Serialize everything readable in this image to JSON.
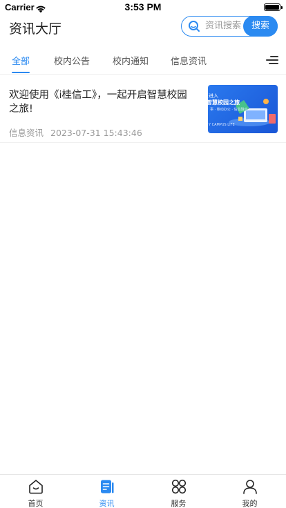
{
  "status_bar": {
    "carrier": "Carrier",
    "time": "3:53 PM",
    "wifi_icon": "wifi-icon",
    "battery_icon": "battery-icon"
  },
  "header": {
    "title": "资讯大厅",
    "search": {
      "placeholder": "资讯搜索",
      "value": "",
      "button_label": "搜索",
      "icon": "search-icon"
    }
  },
  "tabs": {
    "items": [
      {
        "label": "全部",
        "active": true
      },
      {
        "label": "校内公告",
        "active": false
      },
      {
        "label": "校内通知",
        "active": false
      },
      {
        "label": "信息资讯",
        "active": false
      }
    ],
    "menu_icon": "menu-icon"
  },
  "articles": [
    {
      "title": "欢迎使用《i桂信工》，一起开启智慧校园之旅!",
      "category": "信息资讯",
      "date": "2023-07-31 15:43:46",
      "thumbnail": {
        "line1": "进入",
        "line2": "智慧校园之旅",
        "line3": "事 · 移动办公 · 信息融合",
        "line4": "Y CAMPUS LIFE"
      }
    }
  ],
  "tabbar": {
    "items": [
      {
        "label": "首页",
        "icon": "home-icon",
        "active": false
      },
      {
        "label": "资讯",
        "icon": "news-icon",
        "active": true
      },
      {
        "label": "服务",
        "icon": "services-icon",
        "active": false
      },
      {
        "label": "我的",
        "icon": "profile-icon",
        "active": false
      }
    ]
  },
  "colors": {
    "accent": "#2b8af1",
    "text": "#222222",
    "muted": "#999999"
  }
}
